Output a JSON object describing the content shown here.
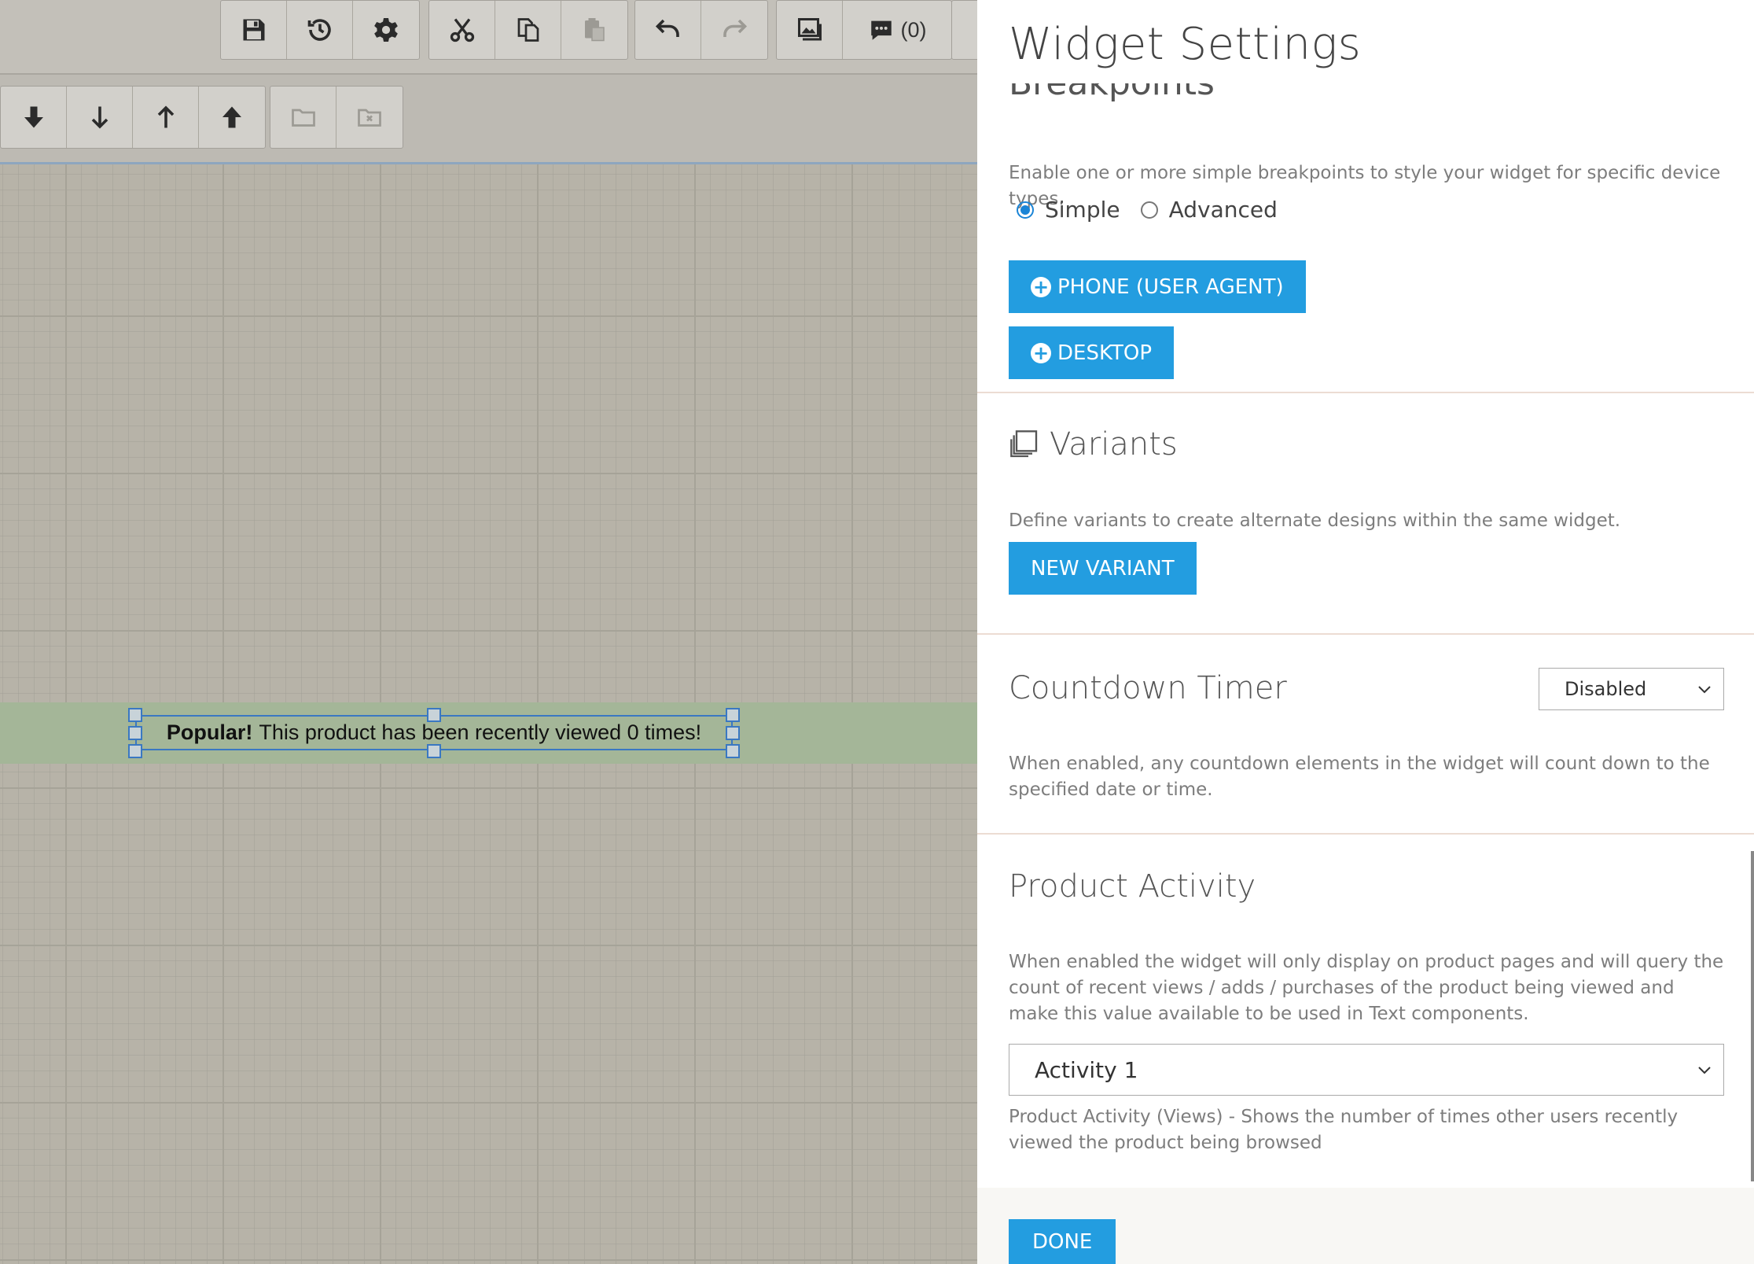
{
  "toolbar": {
    "comment_count": "(0)",
    "buttons": [
      {
        "icon": "floppy-disk-icon"
      },
      {
        "icon": "history-icon"
      },
      {
        "icon": "gear-icon"
      },
      {
        "icon": "cut-icon"
      },
      {
        "icon": "copy-icon"
      },
      {
        "icon": "paste-icon"
      },
      {
        "icon": "undo-icon"
      },
      {
        "icon": "redo-icon"
      },
      {
        "icon": "image-icon"
      },
      {
        "icon": "comment-icon"
      }
    ]
  },
  "subtoolbar": {
    "buttons": [
      {
        "icon": "send-to-back-icon"
      },
      {
        "icon": "send-backward-icon"
      },
      {
        "icon": "bring-forward-icon"
      },
      {
        "icon": "bring-to-front-icon"
      },
      {
        "icon": "folder-icon"
      },
      {
        "icon": "folder-remove-icon"
      }
    ]
  },
  "canvas": {
    "widget_bold": "Popular!",
    "widget_text": "This product has been recently viewed 0 times!"
  },
  "panel": {
    "title": "Widget Settings",
    "breakpoints": {
      "heading_partial": "Breakpoints",
      "description": "Enable one or more simple breakpoints to style your widget for specific device types.",
      "mode_options": [
        "Simple",
        "Advanced"
      ],
      "selected_mode": "Simple",
      "phone_button": "PHONE (USER AGENT)",
      "desktop_button": "DESKTOP"
    },
    "variants": {
      "heading": "Variants",
      "description": "Define variants to create alternate designs within the same widget.",
      "new_button": "NEW VARIANT"
    },
    "countdown": {
      "heading": "Countdown Timer",
      "select_value": "Disabled",
      "description": "When enabled, any countdown elements in the widget will count down to the specified date or time."
    },
    "product_activity": {
      "heading": "Product Activity",
      "description": "When enabled the widget will only display on product pages and will query the count of recent views / adds / purchases of the product being viewed and make this value available to be used in Text components.",
      "select_value": "Activity 1",
      "help": "Product Activity (Views) - Shows the number of times other users recently viewed the product being browsed"
    },
    "done_button": "DONE"
  },
  "colors": {
    "accent": "#239de0",
    "selection": "#3a78c2",
    "widget_bar": "#a4b698"
  }
}
